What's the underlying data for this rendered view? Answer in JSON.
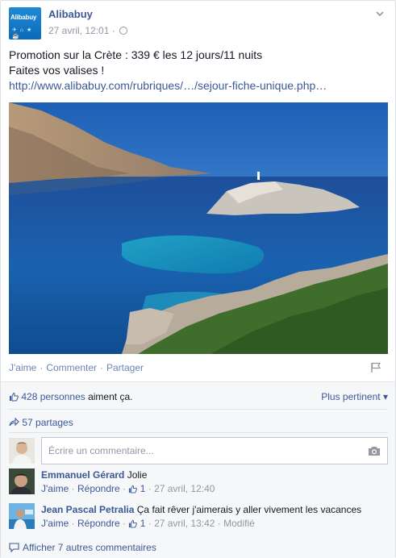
{
  "post": {
    "page_name": "Alibabuy",
    "logo_text": "Alibabuy",
    "logo_icons": "✈ ⌂ ★ ☕",
    "timestamp": "27 avril, 12:01",
    "meta_separator": "·",
    "text_line1": "Promotion sur la Crète : 339 € les 12 jours/11 nuits",
    "text_line2": "Faites vos valises !",
    "link": "http://www.alibabuy.com/rubriques/…/sejour-fiche-unique.php…",
    "photo_icon": "landscape-photo"
  },
  "actions": {
    "like": "J'aime",
    "comment": "Commenter",
    "share": "Partager",
    "separator": "·"
  },
  "feedback": {
    "likes_count": "428 personnes",
    "likes_text": "aiment ça.",
    "sort_label": "Plus pertinent",
    "sort_caret": "▾",
    "shares": "57 partages",
    "comment_placeholder": "Écrire un commentaire...",
    "more_comments": "Afficher 7 autres commentaires"
  },
  "comments": [
    {
      "author": "Emmanuel Gérard",
      "text": "Jolie",
      "like": "J'aime",
      "reply": "Répondre",
      "likes": "1",
      "time": "27 avril, 12:40",
      "edited": ""
    },
    {
      "author": "Jean Pascal Petralia",
      "text": "Ça fait rêver j'aimerais y aller vivement les vacances",
      "like": "J'aime",
      "reply": "Répondre",
      "likes": "1",
      "time": "27 avril, 13:42",
      "edited": "Modifié"
    }
  ],
  "colors": {
    "link": "#3b5998",
    "meta": "#9197a3",
    "feedback_bg": "#f6f7f8",
    "sea": "#1e6fb8"
  }
}
